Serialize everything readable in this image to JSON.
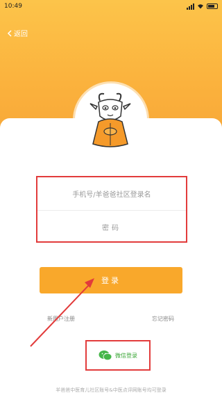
{
  "status_bar": {
    "time": "10:49"
  },
  "header": {
    "back_label": "返回"
  },
  "form": {
    "phone_placeholder": "手机号/羊爸爸社区登录名",
    "password_placeholder": "密码"
  },
  "login_button": {
    "label": "登录"
  },
  "links": {
    "register": "新用户注册",
    "forgot_password": "忘记密码"
  },
  "wechat_login": {
    "label": "微信登录"
  },
  "footer": {
    "note": "羊爸爸中医育儿社区账号&中医点评网账号均可登录"
  },
  "colors": {
    "accent": "#f9a82b",
    "header": "#fbb23d",
    "highlight": "#e23b3b",
    "wechat": "#3aa636"
  }
}
